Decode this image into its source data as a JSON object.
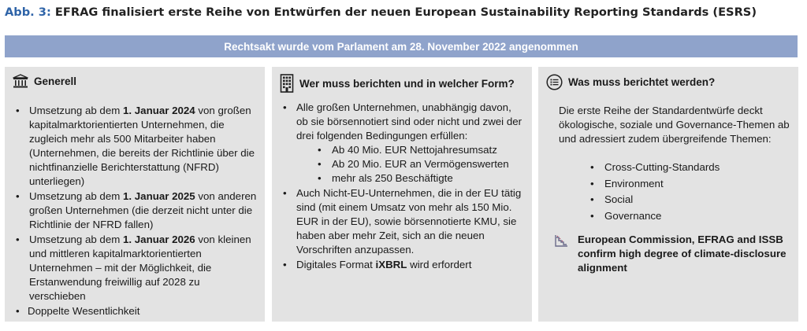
{
  "title": {
    "label": "Abb. 3:",
    "text": "EFRAG finalisiert erste Reihe von Entwürfen der neuen European Sustainability Reporting Standards (ESRS)"
  },
  "banner": "Rechtsakt wurde vom Parlament am 28. November 2022 angenommen",
  "colors": {
    "banner": "#8fa3cb",
    "panel": "#e3e3e3",
    "title_label": "#2f64a8"
  },
  "panel1": {
    "icon": "bank-icon",
    "heading": "Generell",
    "items": [
      {
        "pre": "Umsetzung ab dem ",
        "bold": "1. Januar 2024",
        "post": " von großen kapitalmarktorientierten Unternehmen, die zugleich mehr als 500 Mitarbeiter haben (Unternehmen, die bereits der Richtlinie über die nichtfinanzielle Berichterstattung (NFRD) unterliegen)"
      },
      {
        "pre": "Umsetzung ab dem ",
        "bold": "1. Januar 2025",
        "post": " von anderen großen Unternehmen (die derzeit nicht unter die Richtlinie der NFRD fallen)"
      },
      {
        "pre": "Umsetzung ab dem ",
        "bold": "1. Januar 2026",
        "post": " von kleinen und mittleren kapitalmarktorientierten Unternehmen – mit der Möglichkeit, die Erstanwendung freiwillig auf 2028 zu verschieben"
      },
      {
        "text": "Doppelte Wesentlichkeit"
      }
    ]
  },
  "panel2": {
    "icon": "building-icon",
    "heading": "Wer muss berichten und in welcher Form?",
    "items": [
      {
        "text": "Alle großen Unternehmen, unabhängig davon, ob sie börsennotiert sind oder nicht und zwei der drei folgenden Bedingungen erfüllen:"
      },
      {
        "text": "Auch Nicht-EU-Unternehmen, die in der EU tätig sind (mit einem Umsatz von mehr als 150 Mio. EUR in der EU), sowie börsennotierte KMU, sie haben aber mehr Zeit, sich an die neuen Vorschriften anzupassen."
      },
      {
        "pre": "Digitales Format ",
        "bold": "iXBRL",
        "post": " wird erfordert"
      }
    ],
    "conditions": [
      "Ab 40 Mio. EUR Nettojahresumsatz",
      "Ab 20 Mio. EUR an Vermögenswerten",
      "mehr als 250 Beschäftigte"
    ]
  },
  "panel3": {
    "icon": "list-icon",
    "heading": "Was muss berichtet werden?",
    "intro": "Die erste Reihe der Standardentwürfe deckt ökologische, soziale und Governance-Themen ab und adressiert zudem übergreifende Themen:",
    "themes": [
      "Cross-Cutting-Standards",
      "Environment",
      "Social",
      "Governance"
    ],
    "news_icon": "chart-icon",
    "news": "European Commission, EFRAG and ISSB confirm high degree of climate-disclosure alignment"
  }
}
